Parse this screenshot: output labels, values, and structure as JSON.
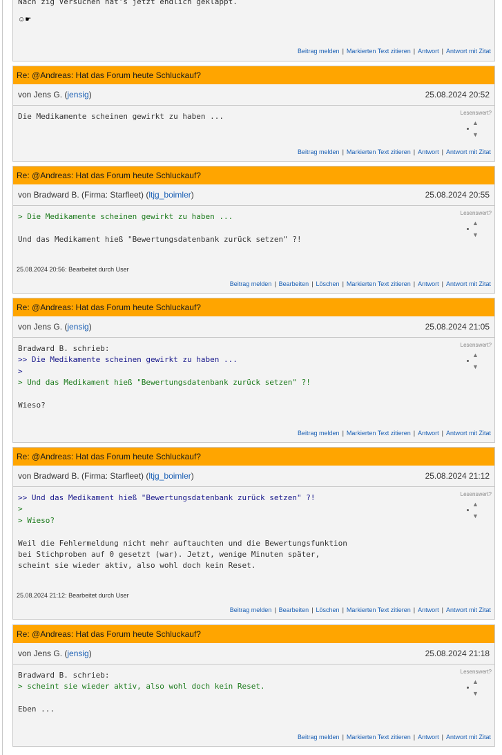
{
  "first_post": {
    "text_line": "Nach zig Versuchen hat's jetzt endlich geklappt.",
    "emoji": "☺☛"
  },
  "labels": {
    "lesenswert": "Lesenswert?",
    "vote_up": "▲",
    "vote_down": "▼",
    "report": "Beitrag melden",
    "quote_marked": "Markierten Text zitieren",
    "reply": "Antwort",
    "reply_quote": "Antwort mit Zitat",
    "edit": "Bearbeiten",
    "delete": "Löschen",
    "separator": "|"
  },
  "posts": [
    {
      "title": "Re: @Andreas: Hat das Forum heute Schluckauf?",
      "author_prefix": "von Jens G. (",
      "username": "jensig",
      "author_suffix": ")",
      "date": "25.08.2024 20:52",
      "lines": [
        "Die Medikamente scheinen gewirkt zu haben ..."
      ]
    },
    {
      "title": "Re: @Andreas: Hat das Forum heute Schluckauf?",
      "author_prefix": "von Bradward B. (Firma: Starfleet) (",
      "username": "ltjg_boimler",
      "author_suffix": ")",
      "date": "25.08.2024 20:55",
      "lines": [
        "> Die Medikamente scheinen gewirkt zu haben ...",
        "",
        "Und das Medikament hieß \"Bewertungsdatenbank zurück setzen\" ?!"
      ],
      "edited": "25.08.2024 20:56: Bearbeitet durch User"
    },
    {
      "title": "Re: @Andreas: Hat das Forum heute Schluckauf?",
      "author_prefix": "von Jens G. (",
      "username": "jensig",
      "author_suffix": ")",
      "date": "25.08.2024 21:05",
      "lines": [
        "Bradward B. schrieb:",
        ">> Die Medikamente scheinen gewirkt zu haben ...",
        ">",
        "> Und das Medikament hieß \"Bewertungsdatenbank zurück setzen\" ?!",
        "",
        "Wieso?"
      ]
    },
    {
      "title": "Re: @Andreas: Hat das Forum heute Schluckauf?",
      "author_prefix": "von Bradward B. (Firma: Starfleet) (",
      "username": "ltjg_boimler",
      "author_suffix": ")",
      "date": "25.08.2024 21:12",
      "lines": [
        ">> Und das Medikament hieß \"Bewertungsdatenbank zurück setzen\" ?!",
        ">",
        "> Wieso?",
        "",
        "Weil die Fehlermeldung nicht mehr auftauchten und die Bewertungsfunktion",
        "bei Stichproben auf 0 gesetzt (war). Jetzt, wenige Minuten später,",
        "scheint sie wieder aktiv, also wohl doch kein Reset."
      ],
      "edited": "25.08.2024 21:12: Bearbeitet durch User"
    },
    {
      "title": "Re: @Andreas: Hat das Forum heute Schluckauf?",
      "author_prefix": "von Jens G. (",
      "username": "jensig",
      "author_suffix": ")",
      "date": "25.08.2024 21:18",
      "lines": [
        "Bradward B. schrieb:",
        "> scheint sie wieder aktiv, also wohl doch kein Reset.",
        "",
        "Eben ..."
      ]
    }
  ]
}
